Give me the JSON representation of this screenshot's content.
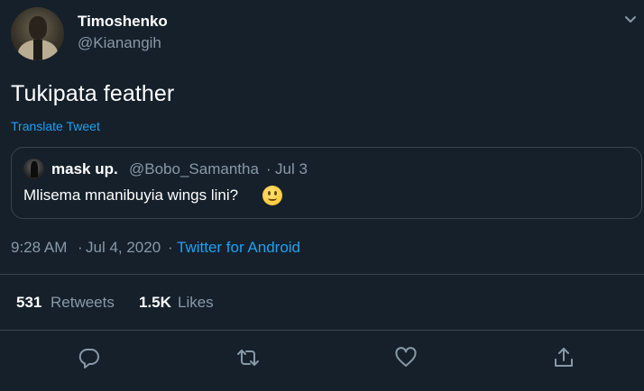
{
  "author": {
    "display_name": "Timoshenko",
    "handle": "@Kianangih"
  },
  "tweet": {
    "text": "Tukipata feather",
    "translate_link": "Translate Tweet"
  },
  "quoted_tweet": {
    "display_name": "mask up.",
    "handle": "@Bobo_Samantha",
    "separator": "·",
    "date": "Jul 3",
    "text": "Mlisema mnanibuyia wings lini?",
    "emoji_icon": "slightly-smiling-face-icon"
  },
  "meta": {
    "time": "9:28 AM",
    "separator": "·",
    "date": "Jul 4, 2020",
    "source": "Twitter for Android"
  },
  "stats": {
    "retweets_count": "531",
    "retweets_label": "Retweets",
    "likes_count": "1.5K",
    "likes_label": "Likes"
  },
  "actions": {
    "reply_icon": "reply-icon",
    "retweet_icon": "retweet-icon",
    "like_icon": "heart-icon",
    "share_icon": "share-icon"
  },
  "colors": {
    "background": "#15202b",
    "primary_text": "#ffffff",
    "secondary_text": "#8899a6",
    "accent": "#1da1f2",
    "border": "#38444d"
  }
}
